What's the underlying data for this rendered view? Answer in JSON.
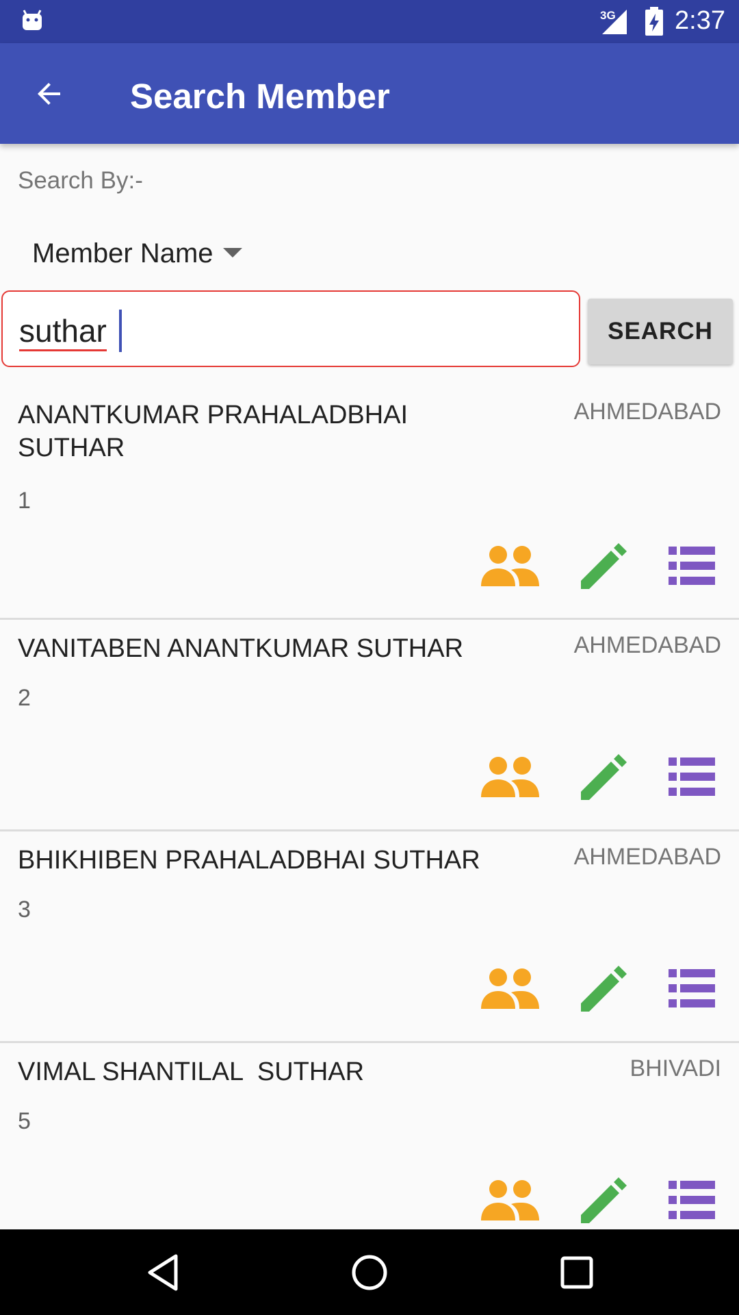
{
  "status_bar": {
    "network": "3G",
    "time": "2:37"
  },
  "app_bar": {
    "title": "Search Member"
  },
  "search": {
    "by_label": "Search By:-",
    "by_selected": "Member Name",
    "query": "suthar",
    "button_label": "SEARCH"
  },
  "results": [
    {
      "name": "ANANTKUMAR PRAHALADBHAI SUTHAR",
      "city": "AHMEDABAD",
      "number": "1"
    },
    {
      "name": "VANITABEN ANANTKUMAR SUTHAR",
      "city": "AHMEDABAD",
      "number": "2"
    },
    {
      "name": "BHIKHIBEN PRAHALADBHAI SUTHAR",
      "city": "AHMEDABAD",
      "number": "3"
    },
    {
      "name": "VIMAL SHANTILAL  SUTHAR",
      "city": "BHIVADI",
      "number": "5"
    }
  ],
  "icons": {
    "family": "group-icon",
    "edit": "pencil-icon",
    "details": "list-icon"
  },
  "colors": {
    "status_bar": "#303f9f",
    "app_bar": "#3f51b5",
    "group_icon": "#f6a623",
    "edit_icon": "#4caf50",
    "list_icon": "#7e57c2",
    "input_error": "#e53935"
  }
}
